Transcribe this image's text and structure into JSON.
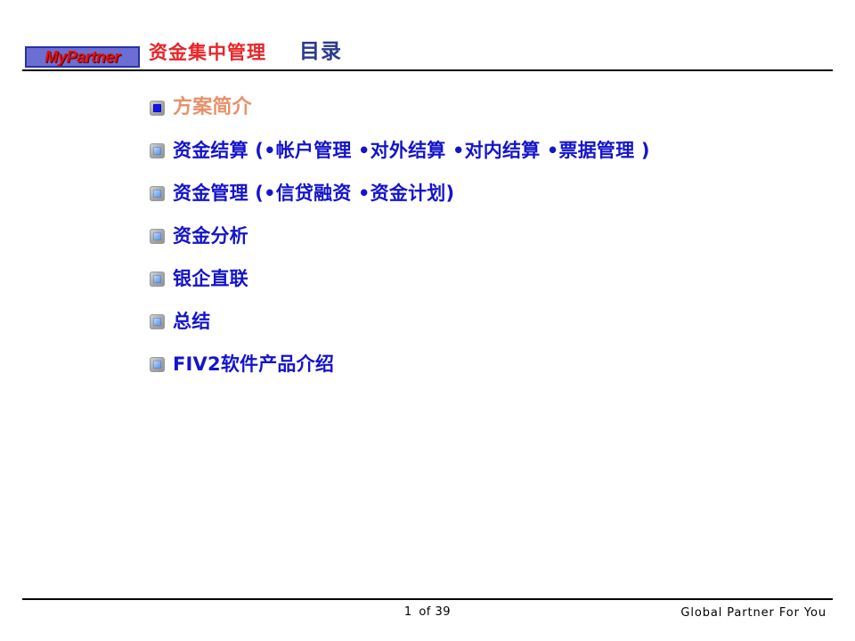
{
  "header": {
    "logo_text": "MyPartner",
    "product_name_cn": "资金集中管理",
    "slide_title": "目录"
  },
  "colors": {
    "header_red": "#E8252A",
    "title_navy": "#2B3A8C",
    "item_blue": "#1414CC",
    "highlight_orange": "#E8906A",
    "logo_background": "#6B6FD4",
    "logo_border": "#2A2FA8",
    "bullet_active": "#1414EE",
    "rule_black": "#000000"
  },
  "toc": {
    "items": [
      {
        "label": "方案简介",
        "bullet": "square-bullet-icon",
        "highlight": true
      },
      {
        "label": "资金结算 (•帐户管理 •对外结算 •对内结算 •票据管理 )",
        "bullet": "square-bullet-icon",
        "highlight": false
      },
      {
        "label": "资金管理 (•信贷融资 •资金计划)",
        "bullet": "square-bullet-icon",
        "highlight": false
      },
      {
        "label": "资金分析",
        "bullet": "square-bullet-icon",
        "highlight": false
      },
      {
        "label": "银企直联",
        "bullet": "square-bullet-icon",
        "highlight": false
      },
      {
        "label": "总结",
        "bullet": "square-bullet-icon",
        "highlight": false
      },
      {
        "label": "FIV2软件产品介绍",
        "bullet": "square-bullet-icon",
        "highlight": false
      }
    ]
  },
  "footer": {
    "page_current": "1",
    "page_separator": "of",
    "page_total": "39",
    "tagline": "Global  Partner  For You"
  }
}
